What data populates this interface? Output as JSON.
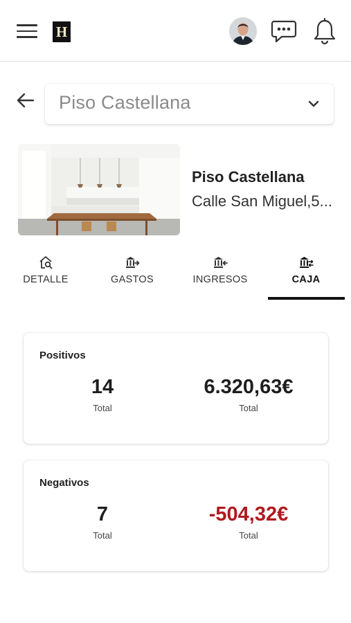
{
  "header": {
    "logo_letter": "H",
    "icons": [
      "menu-icon",
      "chat-icon",
      "bell-icon"
    ]
  },
  "property_select": {
    "value": "Piso Castellana"
  },
  "property": {
    "name": "Piso Castellana",
    "address": "Calle San Miguel,5..."
  },
  "tabs": [
    {
      "label": "DETALLE",
      "icon": "house-search-icon",
      "active": false
    },
    {
      "label": "GASTOS",
      "icon": "bank-arrow-right-icon",
      "active": false
    },
    {
      "label": "INGRESOS",
      "icon": "bank-arrow-left-icon",
      "active": false
    },
    {
      "label": "CAJA",
      "icon": "bank-swap-icon",
      "active": true
    }
  ],
  "positivos": {
    "title": "Positivos",
    "count_value": "14",
    "count_label": "Total",
    "amount_value": "6.320,63€",
    "amount_label": "Total"
  },
  "negativos": {
    "title": "Negativos",
    "count_value": "7",
    "count_label": "Total",
    "amount_value": "-504,32€",
    "amount_label": "Total"
  },
  "colors": {
    "negative": "#b0191e",
    "active_tab": "#111111"
  }
}
